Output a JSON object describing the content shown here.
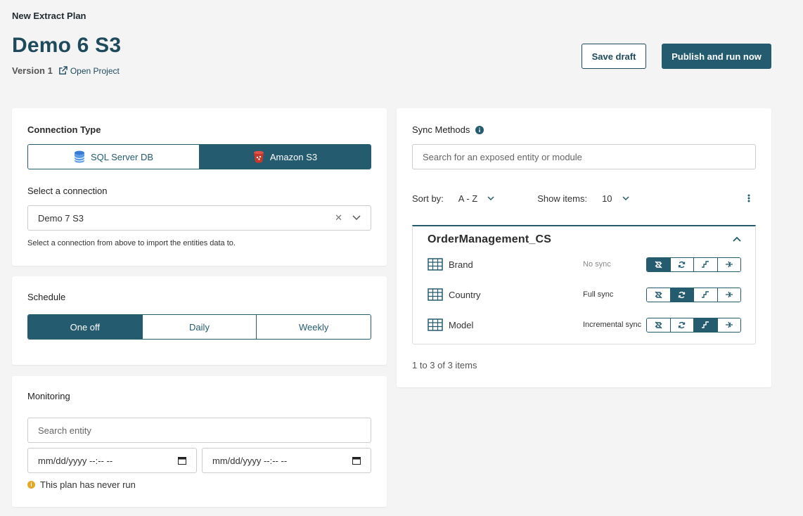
{
  "header": {
    "breadcrumb": "New Extract Plan",
    "title": "Demo 6 S3",
    "version": "Version 1",
    "open_project": "Open Project",
    "save_draft": "Save draft",
    "publish": "Publish and run now"
  },
  "connection": {
    "label": "Connection Type",
    "options": [
      "SQL Server DB",
      "Amazon S3"
    ],
    "selected": "Amazon S3",
    "select_label": "Select a connection",
    "select_value": "Demo 7 S3",
    "hint": "Select a connection from above to import the entities data to."
  },
  "schedule": {
    "label": "Schedule",
    "options": [
      "One off",
      "Daily",
      "Weekly"
    ],
    "selected": "One off"
  },
  "monitoring": {
    "label": "Monitoring",
    "search_placeholder": "Search entity",
    "date_from": "mm/dd/yyyy --:-- --",
    "date_to": "mm/dd/yyyy --:-- --",
    "status": "This plan has never run"
  },
  "sync": {
    "label": "Sync Methods",
    "search_placeholder": "Search for an exposed entity or module",
    "sort_label": "Sort by:",
    "sort_value": "A - Z",
    "show_label": "Show items:",
    "show_value": "10",
    "module": "OrderManagement_CS",
    "entities": [
      {
        "name": "Brand",
        "status": "No sync",
        "mode": 0
      },
      {
        "name": "Country",
        "status": "Full sync",
        "mode": 1
      },
      {
        "name": "Model",
        "status": "Incremental sync",
        "mode": 2
      }
    ],
    "pager": "1 to 3 of 3 items"
  },
  "colors": {
    "accent": "#245b6e",
    "warning": "#e5a825"
  }
}
